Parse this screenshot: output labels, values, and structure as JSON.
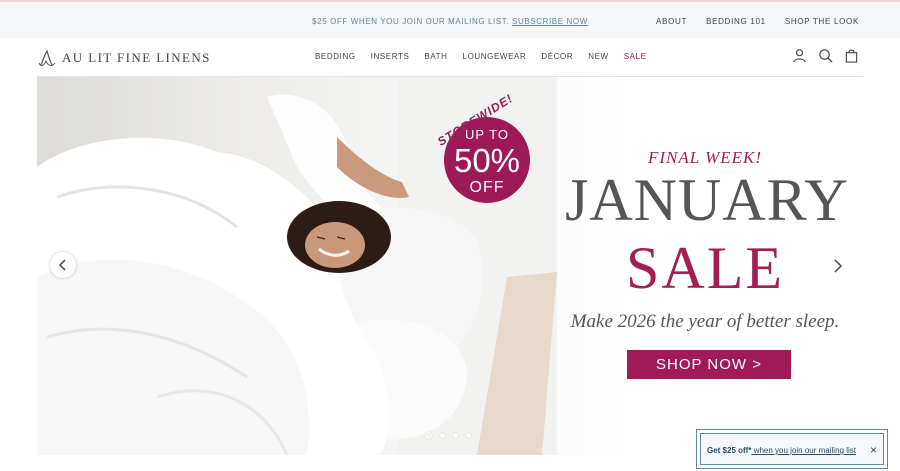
{
  "announcement": {
    "message": "$25 OFF WHEN YOU JOIN OUR MAILING LIST.",
    "link": "SUBSCRIBE NOW"
  },
  "utility_nav": [
    "ABOUT",
    "BEDDING 101",
    "SHOP THE LOOK"
  ],
  "brand": {
    "name": "AU LIT FINE LINENS"
  },
  "main_nav": [
    {
      "label": "BEDDING"
    },
    {
      "label": "INSERTS"
    },
    {
      "label": "BATH"
    },
    {
      "label": "LOUNGEWEAR"
    },
    {
      "label": "DÉCOR"
    },
    {
      "label": "NEW"
    },
    {
      "label": "SALE",
      "color": "#9e1f57"
    }
  ],
  "header_icons": [
    "account-icon",
    "search-icon",
    "cart-icon"
  ],
  "hero": {
    "badge": {
      "arc_text": "STOREWIDE!",
      "line1": "UP TO",
      "line2": "50%",
      "line3": "OFF"
    },
    "kicker": "FINAL WEEK!",
    "headline1": "JANUARY",
    "headline2": "SALE",
    "subheadline": "Make 2026 the year of better sleep.",
    "cta": "SHOP NOW >",
    "accent_color": "#9e1a57",
    "slides_count": 4,
    "active_slide": 1
  },
  "popup": {
    "bold": "Get $25 off*",
    "text": " when you join our mailing list",
    "close": "×"
  }
}
